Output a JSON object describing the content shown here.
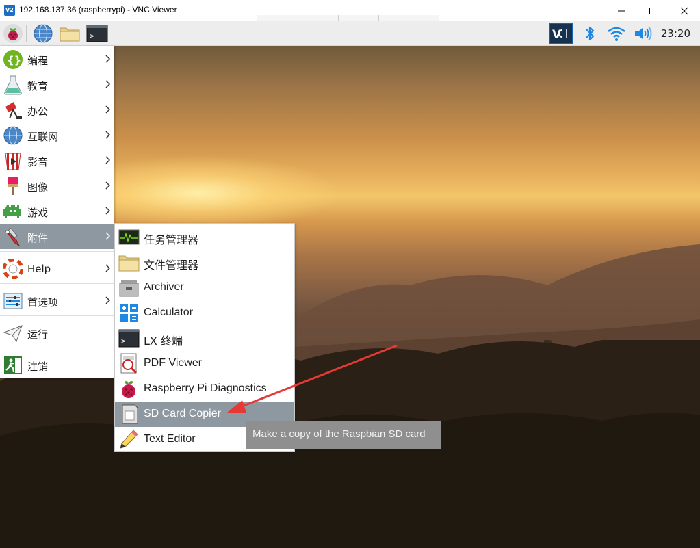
{
  "window": {
    "title": "192.168.137.36 (raspberrypi) - VNC Viewer"
  },
  "taskbar": {
    "clock": "23:20"
  },
  "main_menu": {
    "items": [
      {
        "label": "编程",
        "icon": "programming-icon"
      },
      {
        "label": "教育",
        "icon": "education-icon"
      },
      {
        "label": "办公",
        "icon": "office-icon"
      },
      {
        "label": "互联网",
        "icon": "internet-icon"
      },
      {
        "label": "影音",
        "icon": "sound-video-icon"
      },
      {
        "label": "图像",
        "icon": "graphics-icon"
      },
      {
        "label": "游戏",
        "icon": "games-icon"
      },
      {
        "label": "附件",
        "icon": "accessories-icon",
        "active": true
      },
      {
        "label": "Help",
        "icon": "help-icon"
      },
      {
        "label": "首选项",
        "icon": "preferences-icon"
      },
      {
        "label": "运行",
        "icon": "run-icon"
      },
      {
        "label": "注销",
        "icon": "shutdown-icon"
      }
    ]
  },
  "sub_menu": {
    "items": [
      {
        "label": "任务管理器",
        "icon": "task-manager-icon"
      },
      {
        "label": "文件管理器",
        "icon": "file-manager-icon"
      },
      {
        "label": "Archiver",
        "icon": "archiver-icon"
      },
      {
        "label": "Calculator",
        "icon": "calculator-icon"
      },
      {
        "label": "LX 终端",
        "icon": "terminal-icon"
      },
      {
        "label": "PDF Viewer",
        "icon": "pdf-viewer-icon"
      },
      {
        "label": "Raspberry Pi Diagnostics",
        "icon": "raspberry-icon"
      },
      {
        "label": "SD Card Copier",
        "icon": "sd-card-icon",
        "active": true
      },
      {
        "label": "Text Editor",
        "icon": "text-editor-icon"
      }
    ]
  },
  "tooltip": {
    "text": "Make a copy of the Raspbian SD card"
  },
  "colors": {
    "menu_highlight": "#8e98a1",
    "annotation_arrow": "#e53935",
    "vnc_tray": "#1a5fa8",
    "tray_blue": "#1e88e5"
  }
}
